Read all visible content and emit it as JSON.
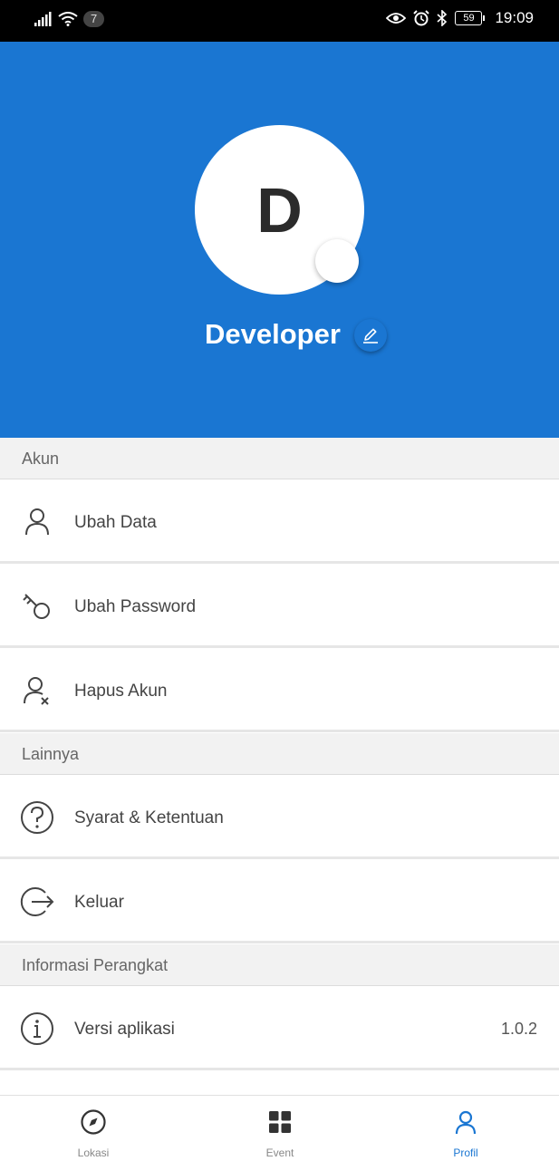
{
  "status_bar": {
    "notification_count": "7",
    "battery": "59",
    "time": "19:09"
  },
  "profile": {
    "avatar_initial": "D",
    "name": "Developer"
  },
  "sections": {
    "akun": "Akun",
    "lainnya": "Lainnya",
    "informasi": "Informasi Perangkat"
  },
  "menu": {
    "ubah_data": "Ubah Data",
    "ubah_password": "Ubah Password",
    "hapus_akun": "Hapus Akun",
    "syarat": "Syarat & Ketentuan",
    "keluar": "Keluar",
    "versi_label": "Versi aplikasi",
    "versi_value": "1.0.2"
  },
  "bottom_nav": [
    {
      "label": "Lokasi",
      "icon": "compass-icon",
      "active": false
    },
    {
      "label": "Event",
      "icon": "grid-icon",
      "active": false
    },
    {
      "label": "Profil",
      "icon": "user-icon",
      "active": true
    }
  ],
  "colors": {
    "primary": "#1a76d2",
    "section_bg": "#f2f2f2"
  }
}
